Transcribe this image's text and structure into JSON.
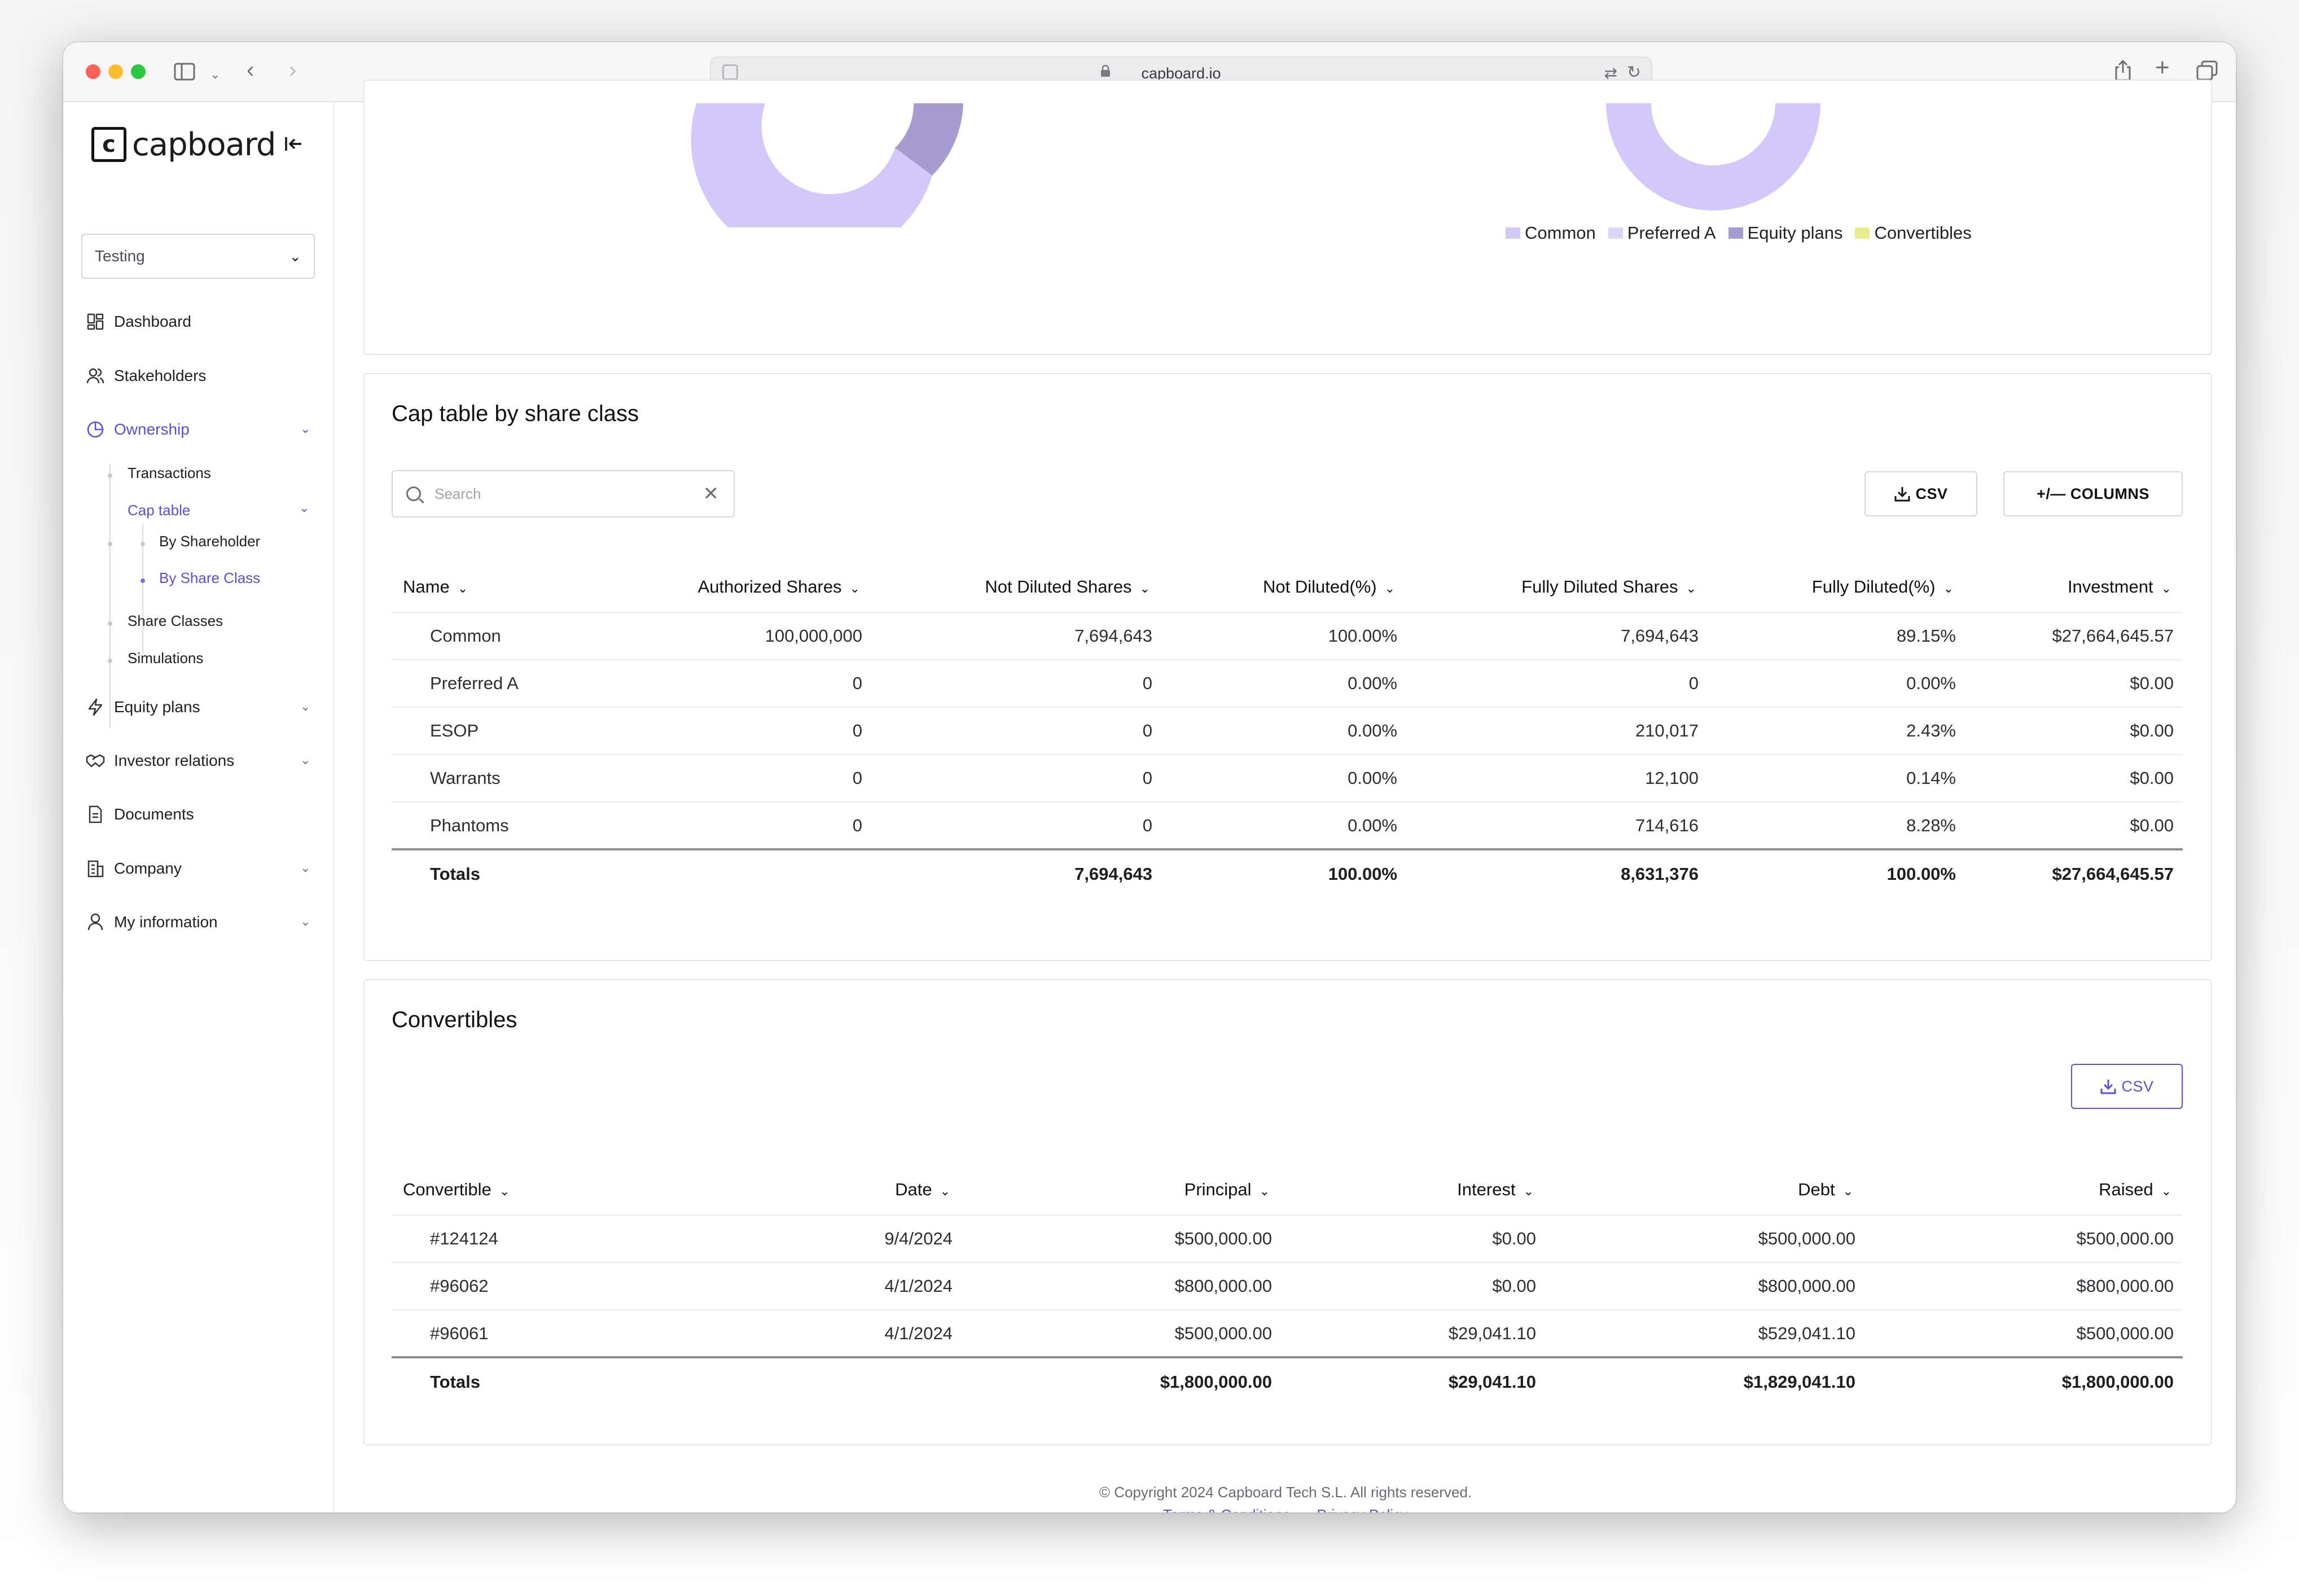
{
  "browser": {
    "url": "capboard.io"
  },
  "sidebar": {
    "logo_letter": "c",
    "logo_text": "capboard",
    "workspace": "Testing",
    "items": [
      {
        "label": "Dashboard"
      },
      {
        "label": "Stakeholders"
      },
      {
        "label": "Ownership"
      },
      {
        "label": "Equity plans"
      },
      {
        "label": "Investor relations"
      },
      {
        "label": "Documents"
      },
      {
        "label": "Company"
      },
      {
        "label": "My information"
      }
    ],
    "ownership_sub": {
      "transactions": "Transactions",
      "cap_table": "Cap table",
      "by_shareholder": "By Shareholder",
      "by_share_class": "By Share Class",
      "share_classes": "Share Classes",
      "simulations": "Simulations"
    }
  },
  "legend": {
    "items": [
      {
        "label": "Common",
        "color": "#d4c8fa"
      },
      {
        "label": "Preferred A",
        "color": "#ddd4fb"
      },
      {
        "label": "Equity plans",
        "color": "#a79bd0"
      },
      {
        "label": "Convertibles",
        "color": "#e8ec8a"
      }
    ]
  },
  "cap_table": {
    "title": "Cap table by share class",
    "search_placeholder": "Search",
    "csv_label": "CSV",
    "columns_label": "+/— COLUMNS",
    "headers": [
      "Name",
      "Authorized Shares",
      "Not Diluted Shares",
      "Not Diluted(%)",
      "Fully Diluted Shares",
      "Fully Diluted(%)",
      "Investment"
    ],
    "rows": [
      [
        "Common",
        "100,000,000",
        "7,694,643",
        "100.00%",
        "7,694,643",
        "89.15%",
        "$27,664,645.57"
      ],
      [
        "Preferred A",
        "0",
        "0",
        "0.00%",
        "0",
        "0.00%",
        "$0.00"
      ],
      [
        "ESOP",
        "0",
        "0",
        "0.00%",
        "210,017",
        "2.43%",
        "$0.00"
      ],
      [
        "Warrants",
        "0",
        "0",
        "0.00%",
        "12,100",
        "0.14%",
        "$0.00"
      ],
      [
        "Phantoms",
        "0",
        "0",
        "0.00%",
        "714,616",
        "8.28%",
        "$0.00"
      ]
    ],
    "totals": [
      "Totals",
      "",
      "7,694,643",
      "100.00%",
      "8,631,376",
      "100.00%",
      "$27,664,645.57"
    ]
  },
  "convertibles": {
    "title": "Convertibles",
    "csv_label": "CSV",
    "headers": [
      "Convertible",
      "Date",
      "Principal",
      "Interest",
      "Debt",
      "Raised"
    ],
    "rows": [
      [
        "#124124",
        "9/4/2024",
        "$500,000.00",
        "$0.00",
        "$500,000.00",
        "$500,000.00"
      ],
      [
        "#96062",
        "4/1/2024",
        "$800,000.00",
        "$0.00",
        "$800,000.00",
        "$800,000.00"
      ],
      [
        "#96061",
        "4/1/2024",
        "$500,000.00",
        "$29,041.10",
        "$529,041.10",
        "$500,000.00"
      ]
    ],
    "totals": [
      "Totals",
      "",
      "$1,800,000.00",
      "$29,041.10",
      "$1,829,041.10",
      "$1,800,000.00"
    ]
  },
  "footer": {
    "copyright": "© Copyright 2024 Capboard Tech S.L. All rights reserved.",
    "terms": "Terms & Conditions",
    "separator": "-",
    "privacy": "Privacy Policy"
  },
  "colors": {
    "accent": "#5b4fd6",
    "donut_light": "#d4c8fa",
    "donut_dark": "#a79bd0"
  }
}
